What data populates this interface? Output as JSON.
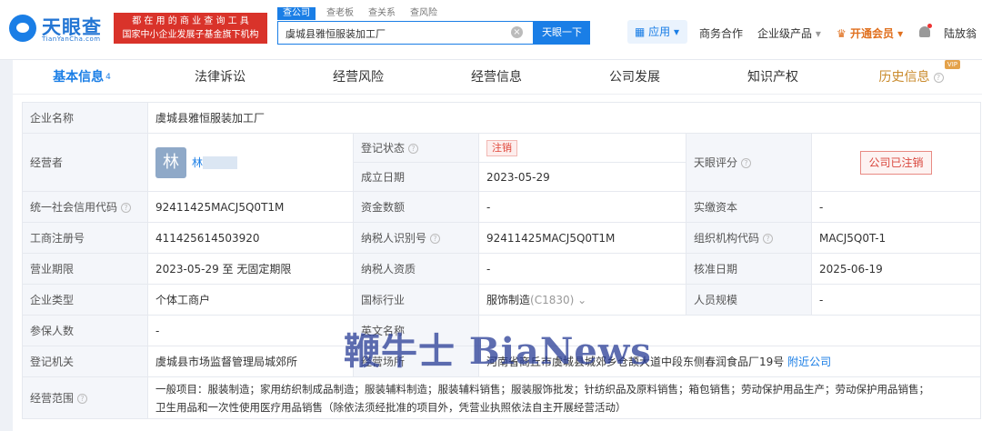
{
  "brand": {
    "name": "天眼查",
    "sub": "TianYanCha.com",
    "slogan_line1": "都 在 用 的 商 业 查 询 工 具",
    "slogan_line2": "国家中小企业发展子基金旗下机构"
  },
  "search": {
    "tabs": [
      "查公司",
      "查老板",
      "查关系",
      "查风险"
    ],
    "value": "虞城县雅恒服装加工厂",
    "button": "天眼一下",
    "clear": "×"
  },
  "nav": {
    "app": "应用",
    "app_icon": "grid-icon",
    "items": [
      "商务合作",
      "企业级产品",
      "开通会员"
    ],
    "user": "陆放翁",
    "accent": "#1a7ee6",
    "vip_color": "#e0701f"
  },
  "tabs": [
    {
      "label": "基本信息",
      "count": "4"
    },
    {
      "label": "法律诉讼"
    },
    {
      "label": "经营风险"
    },
    {
      "label": "经营信息"
    },
    {
      "label": "公司发展"
    },
    {
      "label": "知识产权"
    },
    {
      "label": "历史信息",
      "badge": "VIP"
    }
  ],
  "info": {
    "company_name_label": "企业名称",
    "company_name": "虞城县雅恒服装加工厂",
    "operator_label": "经营者",
    "operator_avatar": "林",
    "operator_name": "林",
    "reg_status_label": "登记状态",
    "reg_status": "注销",
    "found_date_label": "成立日期",
    "found_date": "2023-05-29",
    "score_label": "天眼评分",
    "score_stamp": "公司已注销",
    "credit_code_label": "统一社会信用代码",
    "credit_code": "92411425MACJ5Q0T1M",
    "capital_label": "资金数额",
    "capital": "-",
    "paid_capital_label": "实缴资本",
    "paid_capital": "-",
    "biz_reg_no_label": "工商注册号",
    "biz_reg_no": "411425614503920",
    "taxpayer_id_label": "纳税人识别号",
    "taxpayer_id": "92411425MACJ5Q0T1M",
    "org_code_label": "组织机构代码",
    "org_code": "MACJ5Q0T-1",
    "term_label": "营业期限",
    "term": "2023-05-29 至 无固定期限",
    "taxpayer_qual_label": "纳税人资质",
    "taxpayer_qual": "-",
    "approve_date_label": "核准日期",
    "approve_date": "2025-06-19",
    "type_label": "企业类型",
    "type": "个体工商户",
    "industry_label": "国标行业",
    "industry": "服饰制造",
    "industry_code": "(C1830)",
    "staff_size_label": "人员规模",
    "staff_size": "-",
    "insured_label": "参保人数",
    "insured": "-",
    "en_name_label": "英文名称",
    "en_name": "",
    "authority_label": "登记机关",
    "authority": "虞城县市场监督管理局城郊所",
    "address_label": "经营场所",
    "address": "河南省商丘市虞城县城郊乡仓颉大道中段东侧春润食品厂19号",
    "nearby": "附近公司",
    "scope_label": "经营范围",
    "scope_line1": "一般项目：服装制造；家用纺织制成品制造；服装辅料制造；服装辅料销售；服装服饰批发；针纺织品及原料销售；箱包销售；劳动保护用品生产；劳动保护用品销售；",
    "scope_line2": "卫生用品和一次性使用医疗用品销售（除依法须经批准的项目外，凭营业执照依法自主开展经营活动）"
  },
  "watermark": "鞭牛士 BiaNews"
}
